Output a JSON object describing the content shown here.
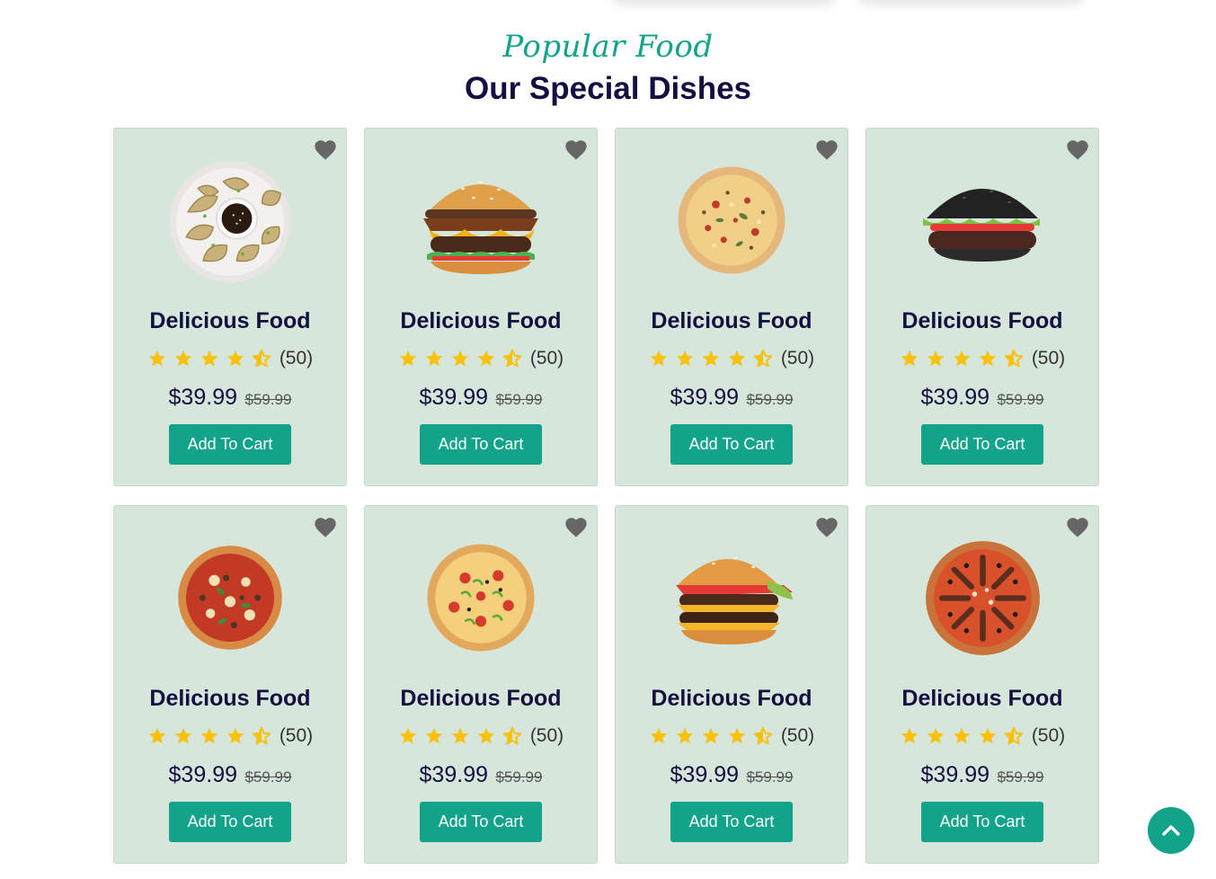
{
  "section": {
    "subtitle": "Popular Food",
    "title": "Our Special Dishes"
  },
  "dishes": [
    {
      "name": "Delicious Food",
      "image": "dumplings",
      "rating_count": "(50)",
      "rating": 4.5,
      "price": "$39.99",
      "old_price": "$59.99",
      "button": "Add To Cart"
    },
    {
      "name": "Delicious Food",
      "image": "burger",
      "rating_count": "(50)",
      "rating": 4.5,
      "price": "$39.99",
      "old_price": "$59.99",
      "button": "Add To Cart"
    },
    {
      "name": "Delicious Food",
      "image": "pizza",
      "rating_count": "(50)",
      "rating": 4.5,
      "price": "$39.99",
      "old_price": "$59.99",
      "button": "Add To Cart"
    },
    {
      "name": "Delicious Food",
      "image": "black-burger",
      "rating_count": "(50)",
      "rating": 4.5,
      "price": "$39.99",
      "old_price": "$59.99",
      "button": "Add To Cart"
    },
    {
      "name": "Delicious Food",
      "image": "pizza-basil",
      "rating_count": "(50)",
      "rating": 4.5,
      "price": "$39.99",
      "old_price": "$59.99",
      "button": "Add To Cart"
    },
    {
      "name": "Delicious Food",
      "image": "pizza-pepper",
      "rating_count": "(50)",
      "rating": 4.5,
      "price": "$39.99",
      "old_price": "$59.99",
      "button": "Add To Cart"
    },
    {
      "name": "Delicious Food",
      "image": "double-burger",
      "rating_count": "(50)",
      "rating": 4.5,
      "price": "$39.99",
      "old_price": "$59.99",
      "button": "Add To Cart"
    },
    {
      "name": "Delicious Food",
      "image": "pizza-sausage",
      "rating_count": "(50)",
      "rating": 4.5,
      "price": "$39.99",
      "old_price": "$59.99",
      "button": "Add To Cart"
    }
  ],
  "icons": {
    "heart": "heart-icon",
    "star": "star-icon",
    "star_half": "star-half-icon",
    "scroll_top": "chevron-up-icon"
  },
  "colors": {
    "accent": "#12a48a",
    "heading": "#130f40",
    "card_bg": "#d7e6da",
    "star": "#f9c10a",
    "heart": "#666666"
  }
}
